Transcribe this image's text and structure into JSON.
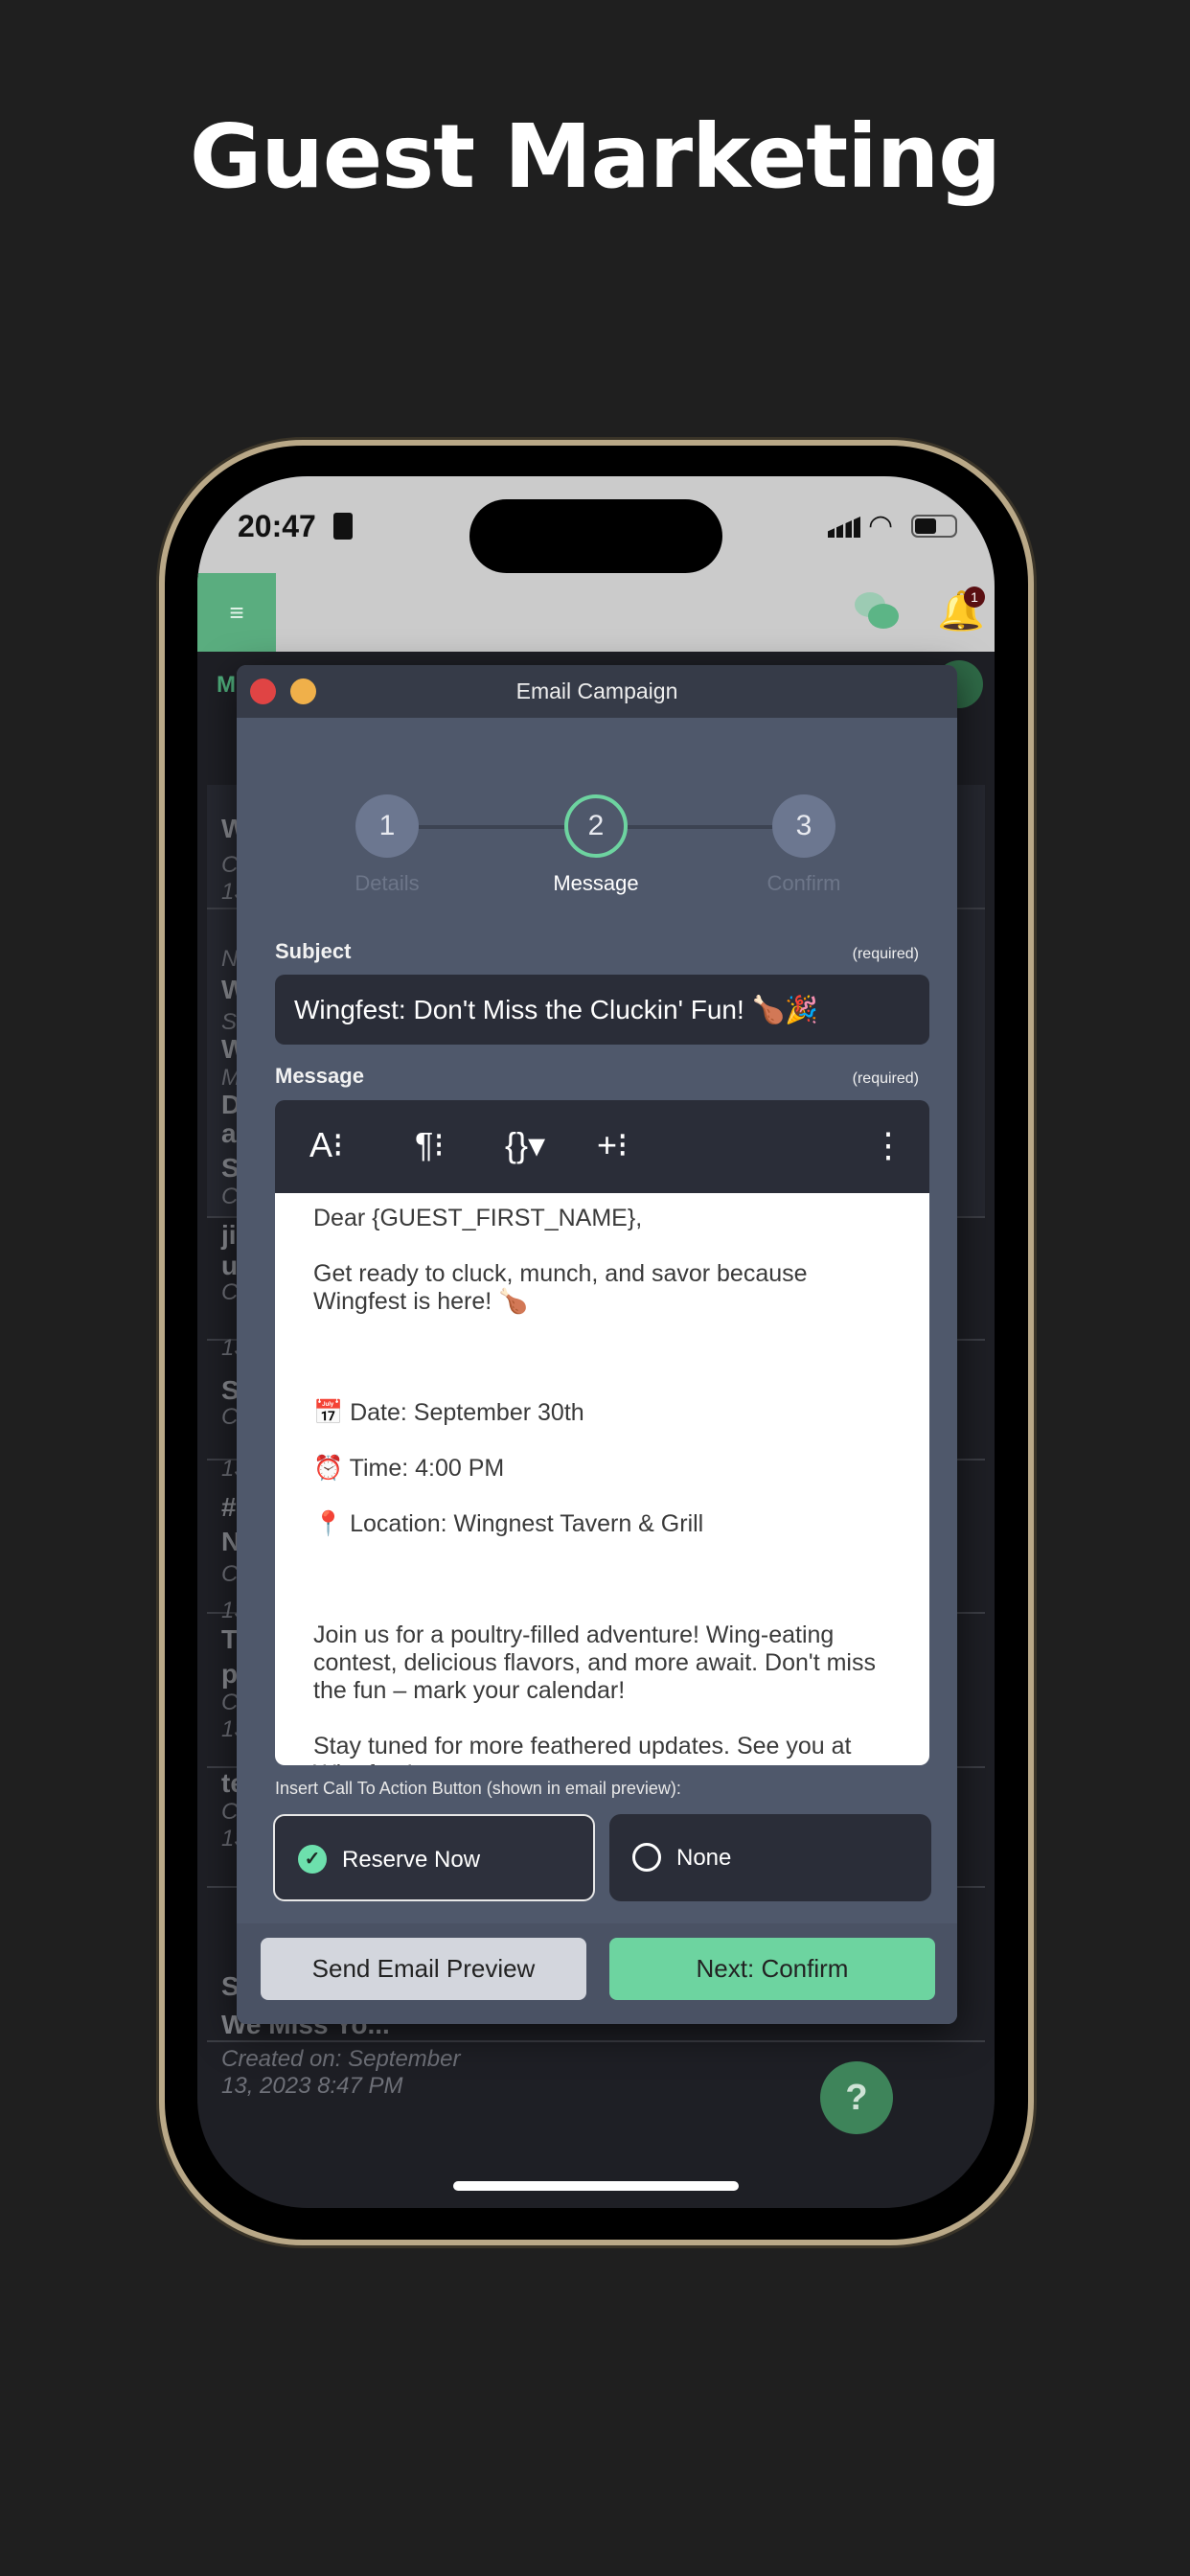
{
  "page_title": "Guest Marketing",
  "status_bar": {
    "time": "20:47",
    "notification_count": "1"
  },
  "background_list": {
    "section_letter": "M",
    "fragments": [
      "W",
      "C",
      "13",
      "N",
      "W",
      "S",
      "W",
      "M",
      "D",
      "a",
      "S",
      "C",
      "ji",
      "u",
      "C",
      "13",
      "S",
      "C",
      "13",
      "#",
      "N",
      "C",
      "13",
      "T",
      "p",
      "C",
      "13",
      "te",
      "C",
      "13",
      "S"
    ],
    "last_item": {
      "title": "We Miss Yo...",
      "created": "Created on: September 13, 2023 8:47 PM"
    }
  },
  "modal": {
    "title": "Email Campaign",
    "steps": [
      {
        "number": "1",
        "label": "Details"
      },
      {
        "number": "2",
        "label": "Message"
      },
      {
        "number": "3",
        "label": "Confirm"
      }
    ],
    "active_step": 2,
    "subject": {
      "label": "Subject",
      "required": "(required)",
      "value": "Wingfest: Don't Miss the Cluckin' Fun! 🍗🎉"
    },
    "message": {
      "label": "Message",
      "required": "(required)",
      "toolbar": [
        "A⁝",
        "¶⁝",
        "{}▾",
        "+⁝",
        "⋮"
      ],
      "lines": [
        "Dear {GUEST_FIRST_NAME},",
        "Get ready to cluck, munch, and savor because Wingfest is here! 🍗",
        "",
        "📅 Date: September 30th",
        "⏰ Time: 4:00 PM",
        "📍 Location: Wingnest Tavern & Grill",
        "",
        "Join us for a poultry-filled adventure! Wing-eating contest, delicious flavors, and more await. Don't miss the fun – mark your calendar!",
        "Stay tuned for more feathered updates. See you at Wingfest!"
      ]
    },
    "cta": {
      "label": "Insert Call To Action Button (shown in email preview):",
      "options": [
        {
          "label": "Reserve Now",
          "selected": true
        },
        {
          "label": "None",
          "selected": false
        }
      ]
    },
    "buttons": {
      "preview": "Send Email Preview",
      "next": "Next: Confirm"
    }
  },
  "help_label": "?",
  "colors": {
    "accent": "#6dd4a0",
    "modal_bg": "#4f586b",
    "close": "#e04444",
    "minimize": "#f0b04a"
  }
}
